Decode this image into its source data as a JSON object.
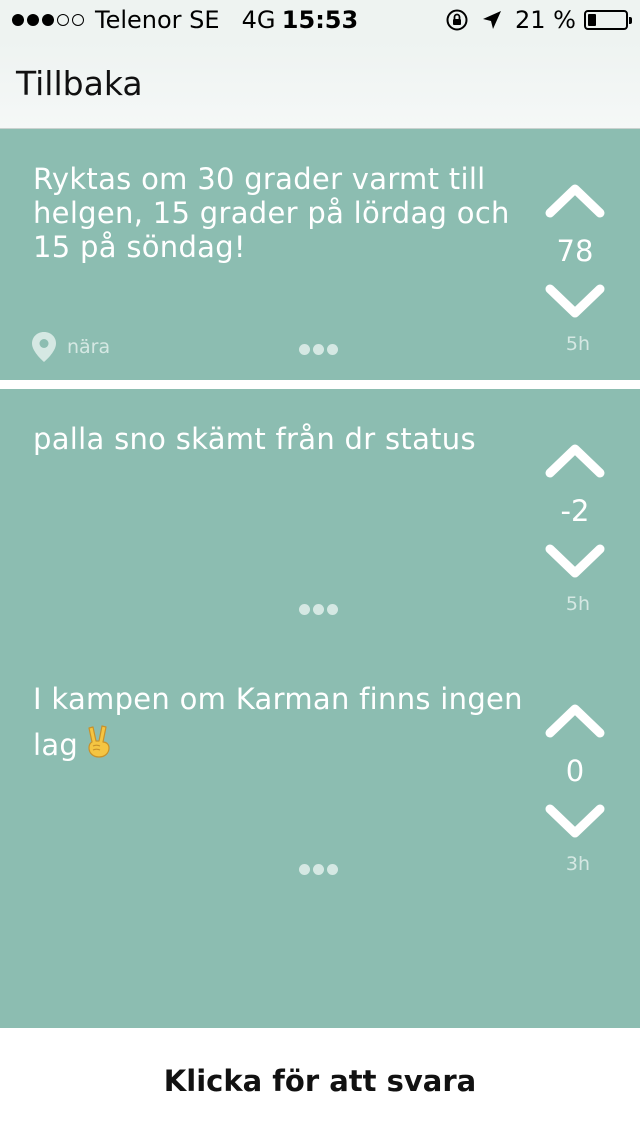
{
  "status_bar": {
    "carrier": "Telenor SE",
    "network": "4G",
    "time": "15:53",
    "battery": "21 %",
    "signal_bars_filled": 3,
    "signal_bars_total": 5
  },
  "nav": {
    "back_label": "Tillbaka"
  },
  "posts": [
    {
      "text": "Ryktas om 30 grader varmt till helgen, 15 grader på lördag och 15 på söndag!",
      "votes": "78",
      "age": "5h",
      "location": "nära"
    },
    {
      "text": "palla sno skämt från dr status",
      "votes": "-2",
      "age": "5h"
    },
    {
      "text": "I kampen om Karman finns ingen lag",
      "votes": "0",
      "age": "3h",
      "emoji": "peace-hand-emoji"
    }
  ],
  "reply_bar": {
    "label": "Klicka för att svara"
  },
  "colors": {
    "post_background": "#8cbdb1",
    "text_on_post": "#ffffff",
    "muted_on_post": "#d5e8e3",
    "navbar_background": "#eef3f1"
  },
  "icons": {
    "upvote": "chevron-up-icon",
    "downvote": "chevron-down-icon",
    "location": "map-pin-icon",
    "more": "ellipsis-dots-icon",
    "orientation_lock": "orientation-lock-icon",
    "gps": "location-arrow-icon"
  }
}
